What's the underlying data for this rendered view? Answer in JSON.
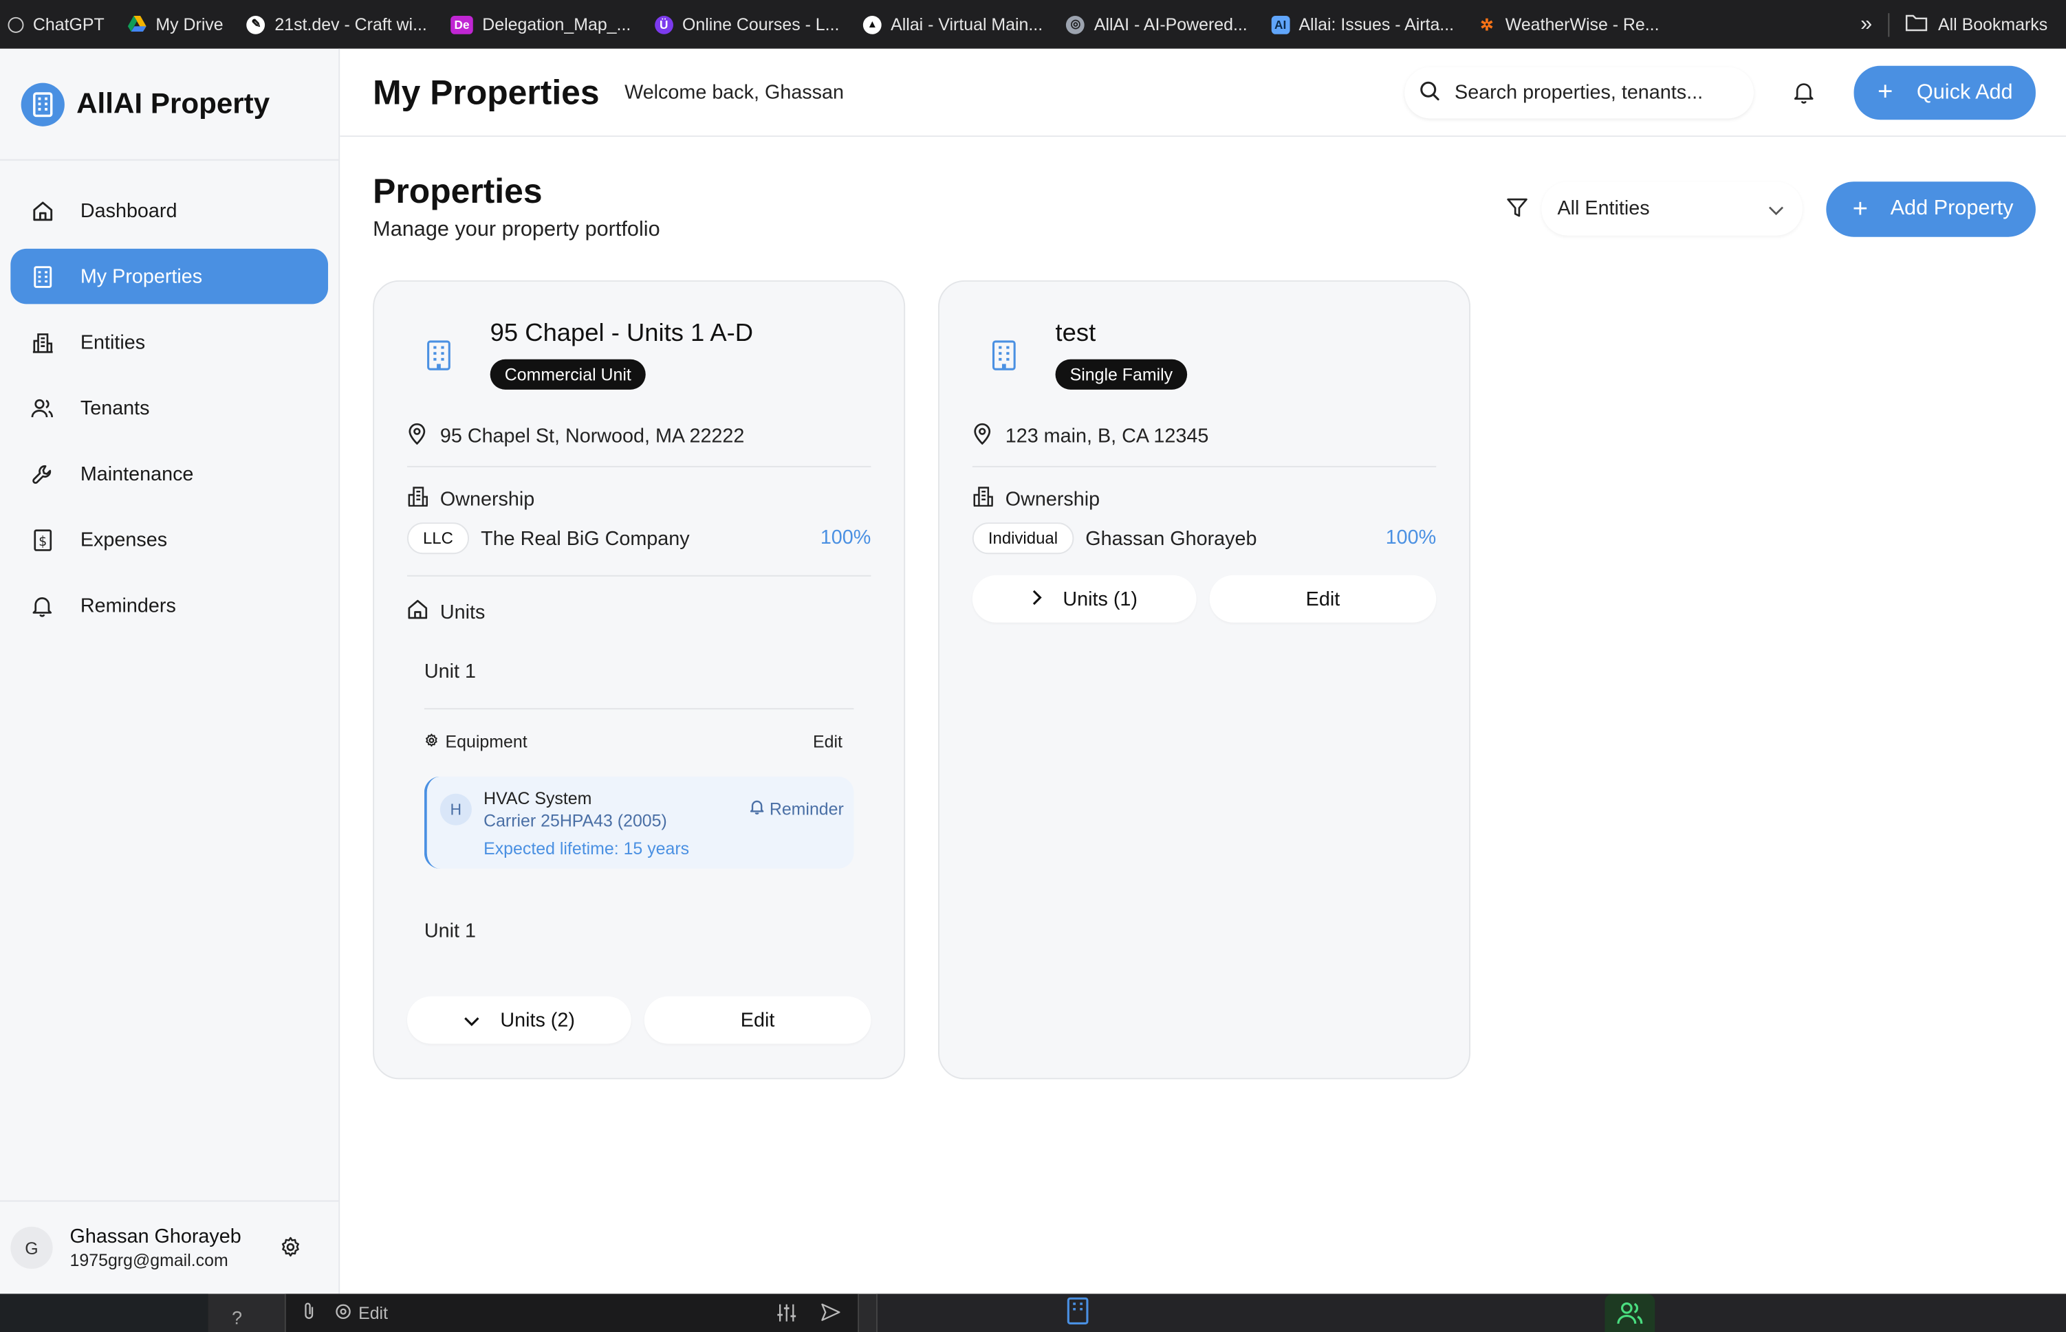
{
  "bookmarks": [
    {
      "label": "ChatGPT",
      "color": "#1f1f21"
    },
    {
      "label": "My Drive",
      "color": "#f4b400"
    },
    {
      "label": "21st.dev - Craft wi...",
      "color": "#ffffff"
    },
    {
      "label": "Delegation_Map_...",
      "color": "#c026d3"
    },
    {
      "label": "Online Courses - L...",
      "color": "#7c3aed"
    },
    {
      "label": "Allai - Virtual Main...",
      "color": "#ffffff"
    },
    {
      "label": "AllAI - AI-Powered...",
      "color": "#9ca3af"
    },
    {
      "label": "Allai: Issues - Airta...",
      "color": "#60a5fa"
    },
    {
      "label": "WeatherWise - Re...",
      "color": "#f97316"
    }
  ],
  "bookmarks_overflow": "»",
  "all_bookmarks": "All Bookmarks",
  "brand": {
    "title": "AllAI Property"
  },
  "nav": [
    {
      "label": "Dashboard",
      "icon": "home-icon"
    },
    {
      "label": "My Properties",
      "icon": "building-icon"
    },
    {
      "label": "Entities",
      "icon": "entities-icon"
    },
    {
      "label": "Tenants",
      "icon": "users-icon"
    },
    {
      "label": "Maintenance",
      "icon": "wrench-icon"
    },
    {
      "label": "Expenses",
      "icon": "receipt-icon"
    },
    {
      "label": "Reminders",
      "icon": "bell-icon"
    }
  ],
  "user": {
    "initial": "G",
    "name": "Ghassan Ghorayeb",
    "email": "1975grg@gmail.com"
  },
  "header": {
    "title": "My Properties",
    "welcome": "Welcome back, Ghassan",
    "search_placeholder": "Search properties, tenants...",
    "quick_add": "Quick Add"
  },
  "section": {
    "title": "Properties",
    "subtitle": "Manage your property portfolio",
    "filter_value": "All Entities",
    "add_property": "Add Property"
  },
  "properties": [
    {
      "name": "95 Chapel - Units 1 A-D",
      "type": "Commercial Unit",
      "address": "95 Chapel St, Norwood, MA 22222",
      "ownership_label": "Ownership",
      "owner_type": "LLC",
      "owner_name": "The Real BiG Company",
      "owner_pct": "100%",
      "units_label": "Units",
      "unit_1": "Unit 1",
      "equipment_label": "Equipment",
      "equipment_edit": "Edit",
      "equipment": {
        "badge": "H",
        "name": "HVAC System",
        "model": "Carrier 25HPA43 (2005)",
        "lifetime": "Expected lifetime: 15 years",
        "reminder": "Reminder"
      },
      "unit_2": "Unit 1",
      "units_toggle": "Units (2)",
      "edit": "Edit"
    },
    {
      "name": "test",
      "type": "Single Family",
      "address": "123 main, B, CA 12345",
      "ownership_label": "Ownership",
      "owner_type": "Individual",
      "owner_name": "Ghassan Ghorayeb",
      "owner_pct": "100%",
      "units_toggle": "Units (1)",
      "edit": "Edit"
    }
  ],
  "bottom_strip": {
    "help": "?",
    "edit": "Edit"
  },
  "colors": {
    "accent": "#4a90e2",
    "sidebar_bg": "#f6f7f9"
  }
}
